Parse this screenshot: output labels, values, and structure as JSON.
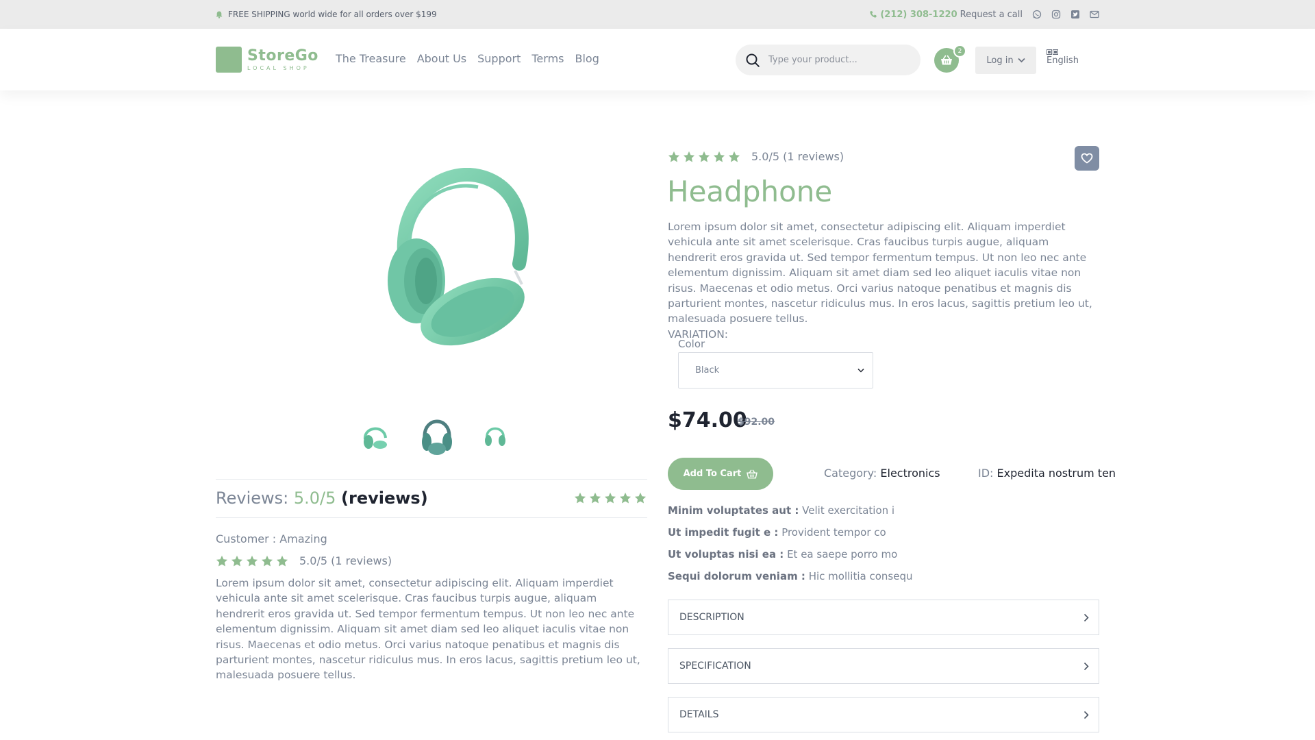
{
  "topbar": {
    "shipping_text": "FREE SHIPPING world wide for all orders over $199",
    "phone": "(212) 308-1220",
    "request_call": "Request a call",
    "social_icons": [
      "whatsapp-icon",
      "instagram-icon",
      "twitter-icon",
      "mail-icon"
    ]
  },
  "header": {
    "logo_name": "StoreGo",
    "logo_tagline": "LOCAL SHOP",
    "nav": [
      "The Treasure",
      "About Us",
      "Support",
      "Terms",
      "Blog"
    ],
    "search_placeholder": "Type your product...",
    "cart_count": "2",
    "login_label": "Log in",
    "language": "English"
  },
  "product": {
    "rating_text": "5.0/5 (1 reviews)",
    "title": "Headphone",
    "description": "Lorem ipsum dolor sit amet, consectetur adipiscing elit. Aliquam imperdiet vehicula ante sit amet scelerisque. Cras faucibus turpis augue, aliquam hendrerit eros gravida ut. Sed tempor fermentum tempus. Ut non leo nec ante elementum dignissim. Aliquam sit amet diam sed leo aliquet iaculis vitae non risus. Maecenas et odio metus. Orci varius natoque penatibus et magnis dis parturient montes, nascetur ridiculus mus. In eros lacus, sagittis pretium leo ut, malesuada posuere tellus.",
    "variation_label": "VARIATION:",
    "color_label": "Color",
    "color_value": "Black",
    "price": "$74.00",
    "old_price": "$92.00",
    "add_to_cart": "Add To Cart",
    "category_label": "Category:",
    "category_value": "Electronics",
    "id_label": "ID:",
    "id_value": "Expedita nostrum ten",
    "attributes": [
      {
        "key": "Minim voluptates aut :",
        "value": "Velit exercitation i"
      },
      {
        "key": "Ut impedit fugit e :",
        "value": "Provident tempor co"
      },
      {
        "key": "Ut voluptas nisi ea :",
        "value": "Et ea saepe porro mo"
      },
      {
        "key": "Sequi dolorum veniam :",
        "value": "Hic mollitia consequ"
      }
    ],
    "accordions": [
      "DESCRIPTION",
      "SPECIFICATION",
      "DETAILS"
    ],
    "rating_stars": 5,
    "accent_color": "#8fbc8f"
  },
  "reviews": {
    "heading_label": "Reviews:",
    "heading_score": "5.0/5",
    "heading_suffix": "(reviews)",
    "customer_label": "Customer :",
    "customer_value": "Amazing",
    "review_rating_text": "5.0/5 (1 reviews)",
    "review_body": "Lorem ipsum dolor sit amet, consectetur adipiscing elit. Aliquam imperdiet vehicula ante sit amet scelerisque. Cras faucibus turpis augue, aliquam hendrerit eros gravida ut. Sed tempor fermentum tempus. Ut non leo nec ante elementum dignissim. Aliquam sit amet diam sed leo aliquet iaculis vitae non risus. Maecenas et odio metus. Orci varius natoque penatibus et magnis dis parturient montes, nascetur ridiculus mus. In eros lacus, sagittis pretium leo ut, malesuada posuere tellus."
  }
}
